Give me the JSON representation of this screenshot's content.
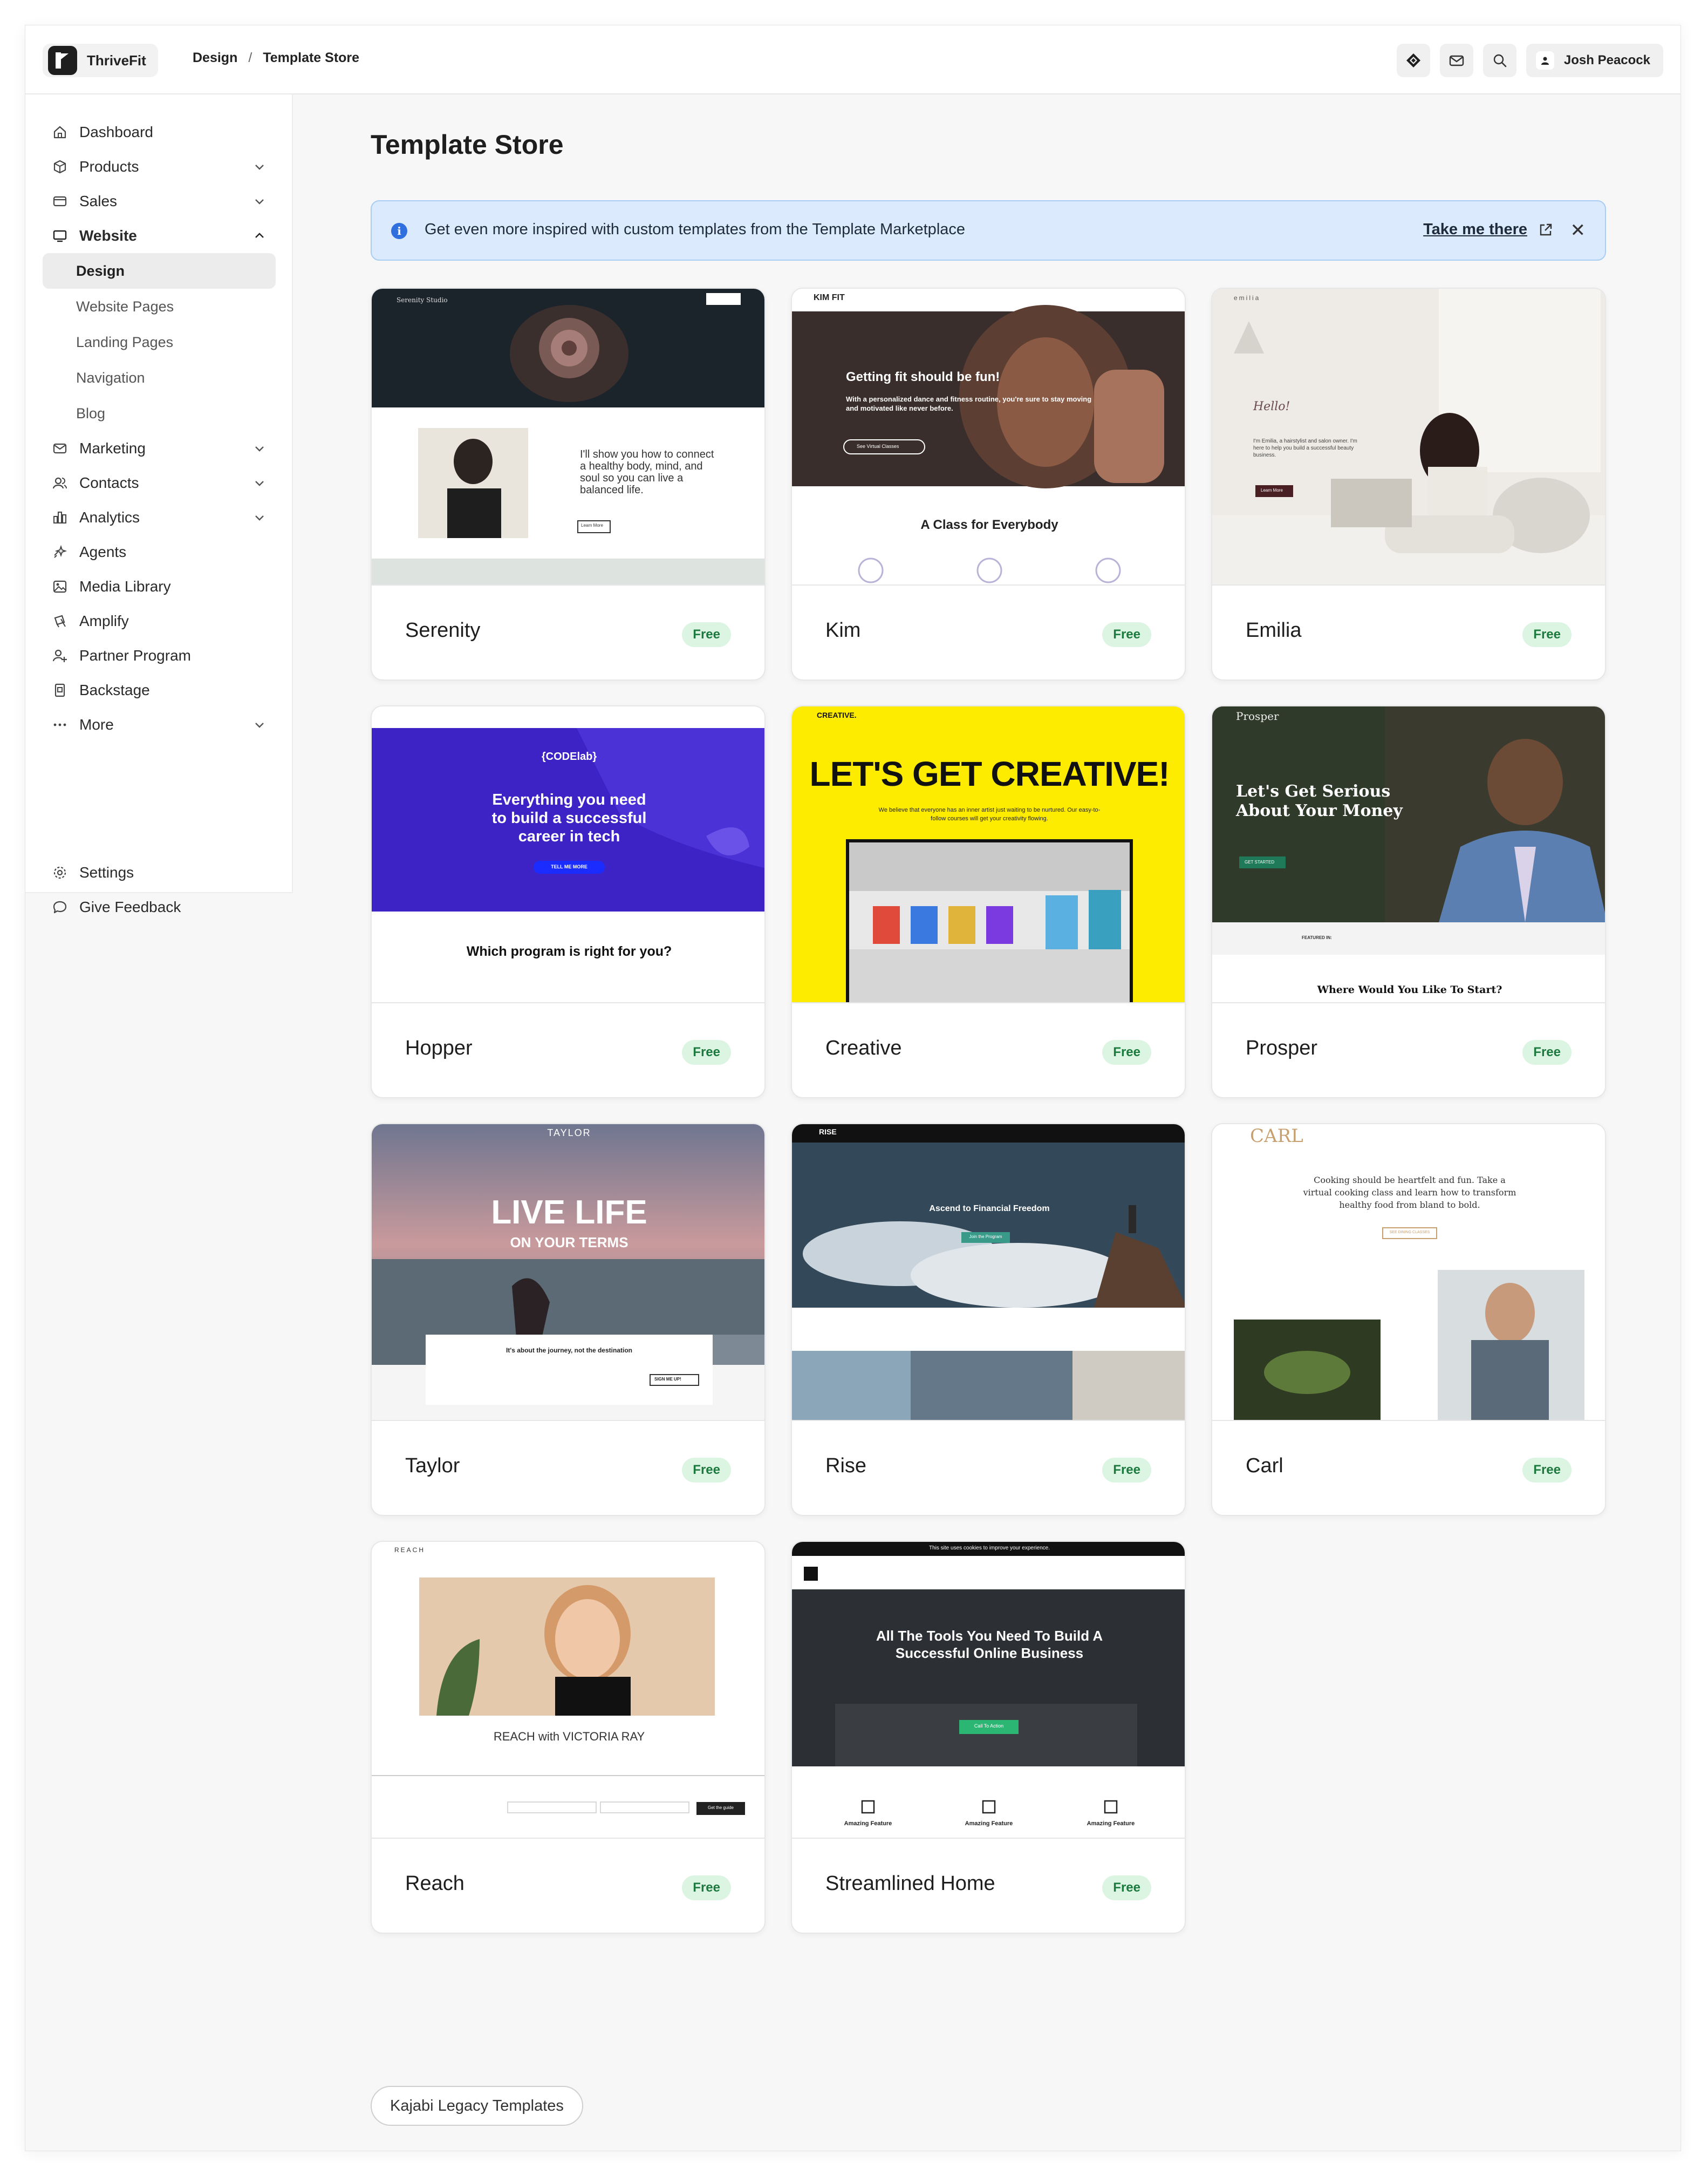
{
  "app": {
    "name": "ThriveFit"
  },
  "breadcrumb": {
    "section": "Design",
    "separator": "/",
    "page": "Template Store"
  },
  "user": {
    "name": "Josh Peacock"
  },
  "sidebar": {
    "items": [
      {
        "label": "Dashboard",
        "icon": "home-icon"
      },
      {
        "label": "Products",
        "icon": "cube-icon"
      },
      {
        "label": "Sales",
        "icon": "card-icon"
      },
      {
        "label": "Website",
        "icon": "monitor-icon"
      }
    ],
    "website_sub": [
      "Design",
      "Website Pages",
      "Landing Pages",
      "Navigation",
      "Blog"
    ],
    "items2": [
      {
        "label": "Marketing",
        "icon": "mail-icon"
      },
      {
        "label": "Contacts",
        "icon": "users-icon"
      },
      {
        "label": "Analytics",
        "icon": "bar-chart-icon"
      },
      {
        "label": "Agents",
        "icon": "sparkle-icon"
      },
      {
        "label": "Media Library",
        "icon": "image-icon"
      },
      {
        "label": "Amplify",
        "icon": "amplify-icon"
      },
      {
        "label": "Partner Program",
        "icon": "partner-icon"
      },
      {
        "label": "Backstage",
        "icon": "backstage-icon"
      },
      {
        "label": "More",
        "icon": "dots-icon"
      }
    ],
    "bottom": [
      {
        "label": "Settings",
        "icon": "gear-icon"
      },
      {
        "label": "Give Feedback",
        "icon": "chat-icon"
      }
    ]
  },
  "page": {
    "title": "Template Store"
  },
  "banner": {
    "text": "Get even more inspired with custom templates from the Template Marketplace",
    "link": "Take me there"
  },
  "templates": [
    {
      "name": "Serenity",
      "badge": "Free",
      "preview": {
        "brand": "Serenity Studio",
        "headline": "I'll show you how to connect a healthy body, mind, and soul so you can live a balanced life.",
        "cta": "Learn More"
      }
    },
    {
      "name": "Kim",
      "badge": "Free",
      "preview": {
        "brand": "KIM FIT",
        "headline": "Getting fit should be fun!",
        "sub": "With a personalized dance and fitness routine, you're sure to stay moving and motivated like never before.",
        "cta": "See Virtual Classes",
        "section": "A Class for Everybody"
      }
    },
    {
      "name": "Emilia",
      "badge": "Free",
      "preview": {
        "brand": "emilia",
        "hello": "Hello!",
        "text": "I'm Emilia, a hairstylist and salon owner. I'm here to help you build a successful beauty business.",
        "cta": "Learn More"
      }
    },
    {
      "name": "Hopper",
      "badge": "Free",
      "preview": {
        "brand": "{CODElab}",
        "headline": "Everything you need to build a successful career in tech",
        "cta": "TELL ME MORE",
        "section": "Which program is right for you?"
      }
    },
    {
      "name": "Creative",
      "badge": "Free",
      "preview": {
        "brand": "CREATIVE.",
        "headline": "LET'S GET CREATIVE!",
        "sub": "We believe that everyone has an inner artist just waiting to be nurtured. Our easy-to-follow courses will get your creativity flowing."
      }
    },
    {
      "name": "Prosper",
      "badge": "Free",
      "preview": {
        "brand": "Prosper",
        "headline": "Let's Get Serious About Your Money",
        "cta": "GET STARTED",
        "featured": "FEATURED IN:",
        "section": "Where Would You Like To Start?"
      }
    },
    {
      "name": "Taylor",
      "badge": "Free",
      "preview": {
        "brand": "TAYLOR",
        "headline": "LIVE LIFE",
        "sub": "ON YOUR TERMS",
        "box": "It's about the journey, not the destination",
        "cta": "SIGN ME UP!"
      }
    },
    {
      "name": "Rise",
      "badge": "Free",
      "preview": {
        "brand": "RISE",
        "headline": "Ascend to Financial Freedom",
        "cta": "Join the Program"
      }
    },
    {
      "name": "Carl",
      "badge": "Free",
      "preview": {
        "brand": "CARL",
        "text": "Cooking should be heartfelt and fun. Take a virtual cooking class and learn how to transform healthy food from bland to bold.",
        "cta": "SEE DINING CLASSES"
      }
    },
    {
      "name": "Reach",
      "badge": "Free",
      "preview": {
        "brand": "REACH",
        "headline": "REACH with VICTORIA RAY",
        "cta": "Get the guide"
      }
    },
    {
      "name": "Streamlined Home",
      "badge": "Free",
      "preview": {
        "cookie": "This site uses cookies to improve your experience.",
        "headline": "All The Tools You Need To Build A Successful Online Business",
        "cta": "Call To Action",
        "feature": "Amazing Feature"
      }
    }
  ],
  "legacy_button": "Kajabi Legacy Templates",
  "colors": {
    "banner_bg": "#dbeafd",
    "badge_bg": "#dcf5e3",
    "badge_text": "#1c7a3e",
    "accent_blue": "#2f6fde"
  }
}
